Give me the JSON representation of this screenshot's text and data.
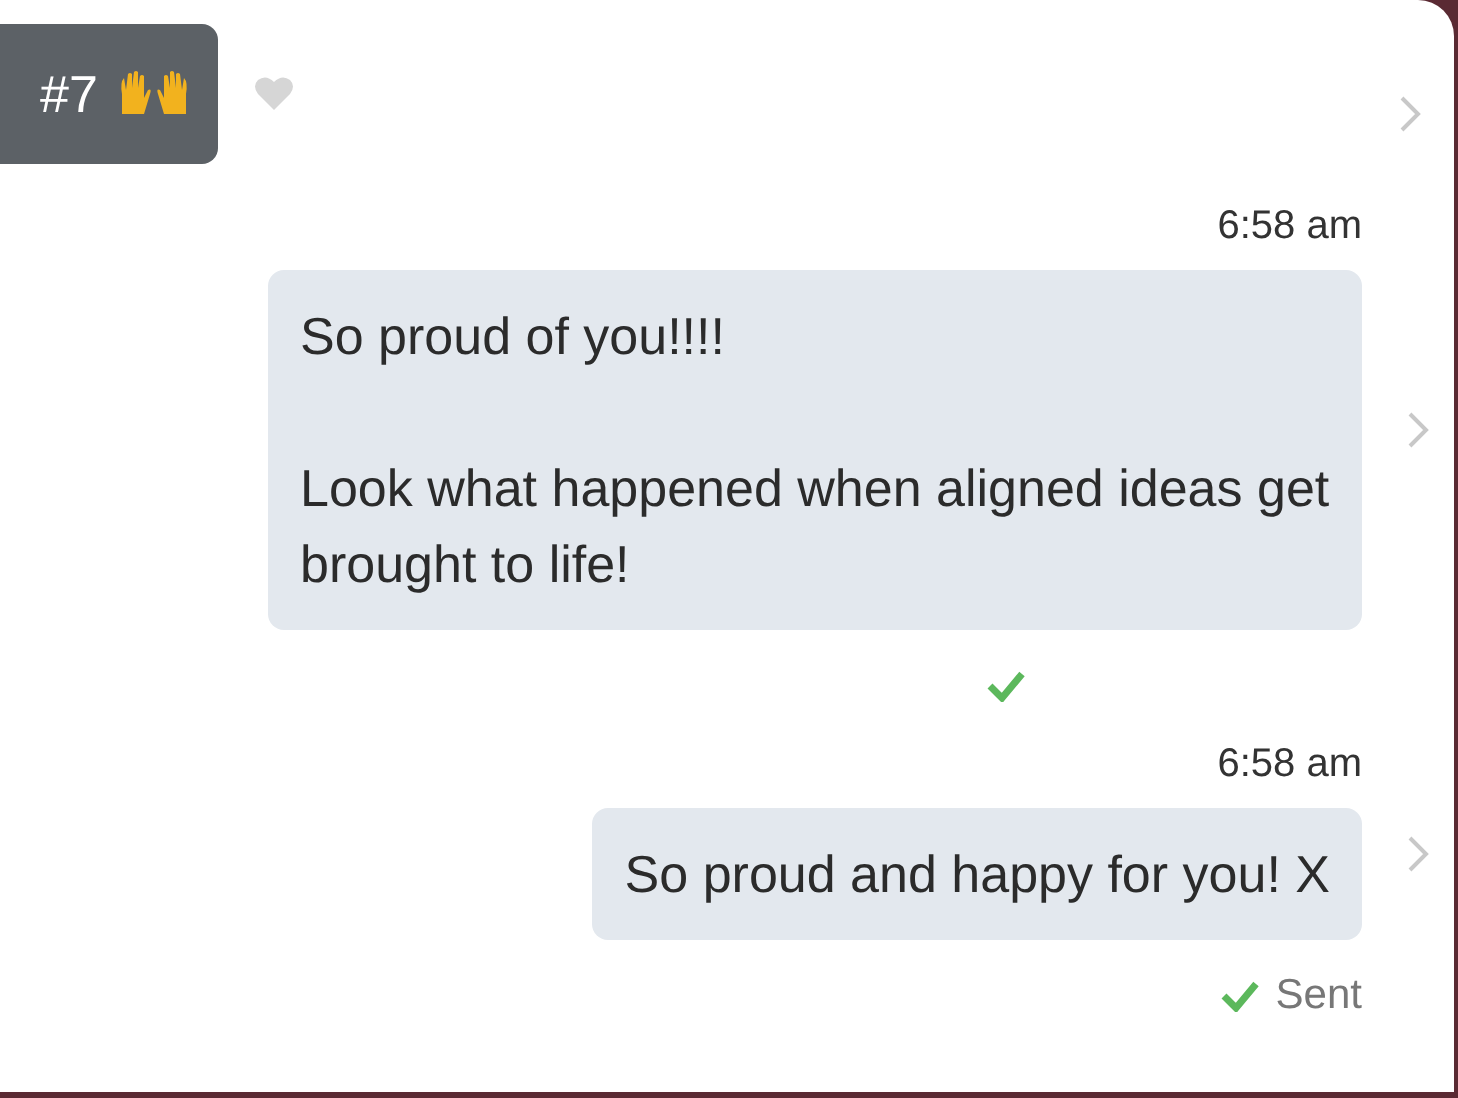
{
  "header": {
    "badge": "#7",
    "liked": false
  },
  "messages": [
    {
      "time": "6:58 am",
      "paragraphs": [
        "So proud of you!!!!",
        "Look what happened when aligned ideas get brought to life!"
      ],
      "status": {
        "kind": "delivered"
      }
    },
    {
      "time": "6:58 am",
      "paragraphs": [
        "So proud and happy for you! X"
      ],
      "status": {
        "kind": "sent",
        "label": "Sent"
      }
    }
  ]
}
